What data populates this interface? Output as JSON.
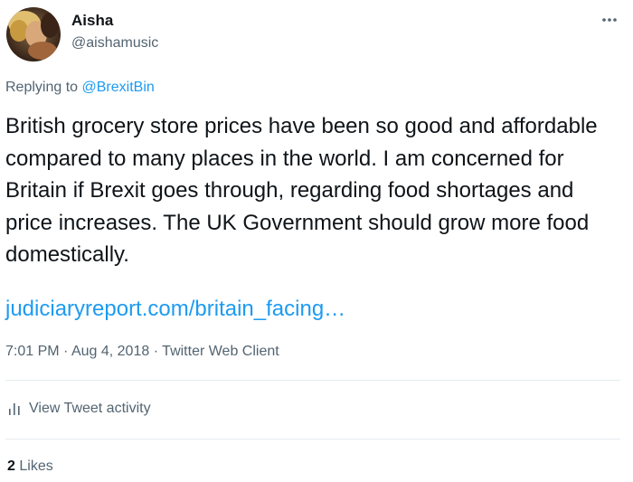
{
  "author": {
    "display_name": "Aisha",
    "handle": "@aishamusic"
  },
  "reply": {
    "prefix": "Replying to",
    "mention": "@BrexitBin"
  },
  "tweet": {
    "text": "British grocery store prices have been so good and affordable compared to many places in the world. I am concerned for Britain if Brexit goes through, regarding food shortages and price increases. The UK Government should grow more food domestically.",
    "link": "judiciaryreport.com/britain_facing…"
  },
  "meta": {
    "time": "7:01 PM",
    "date": "Aug 4, 2018",
    "client": "Twitter Web Client",
    "separator": "·"
  },
  "activity": {
    "label": "View Tweet activity",
    "icon": "bar-chart-icon"
  },
  "likes": {
    "count": "2",
    "label": "Likes"
  },
  "icons": {
    "more": "more-dots-icon"
  },
  "colors": {
    "accent": "#1d9bf0",
    "secondary_text": "#536471",
    "primary_text": "#0f1419",
    "divider": "#e6ecf0"
  }
}
